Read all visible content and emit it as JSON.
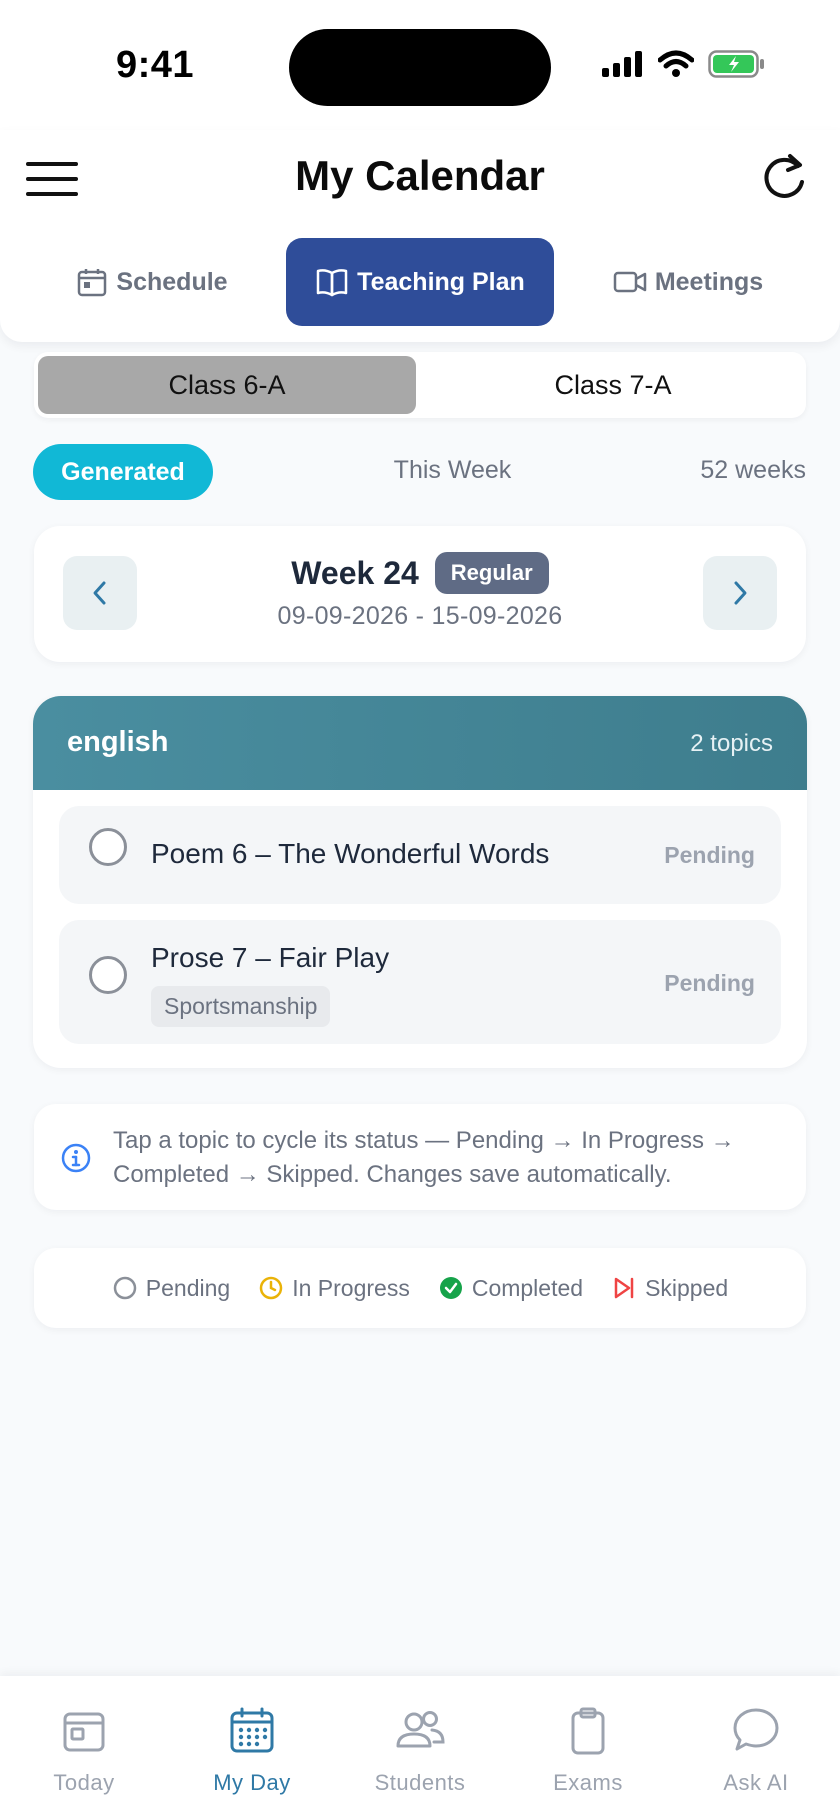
{
  "status_bar": {
    "time": "9:41"
  },
  "header": {
    "title": "My Calendar"
  },
  "tabs": [
    {
      "label": "Schedule",
      "icon": "calendar-icon",
      "active": false
    },
    {
      "label": "Teaching Plan",
      "icon": "book-open-icon",
      "active": true
    },
    {
      "label": "Meetings",
      "icon": "video-icon",
      "active": false
    }
  ],
  "classes": [
    {
      "label": "Class 6-A",
      "selected": true
    },
    {
      "label": "Class 7-A",
      "selected": false
    }
  ],
  "filters": {
    "generated": "Generated",
    "this_week": "This Week",
    "weeks_count": "52 weeks"
  },
  "week": {
    "title": "Week 24",
    "badge": "Regular",
    "range": "09-09-2026 - 15-09-2026"
  },
  "subject": {
    "name": "english",
    "topic_count": "2 topics",
    "topics": [
      {
        "title": "Poem 6 – The Wonderful Words",
        "status": "Pending",
        "tag": ""
      },
      {
        "title": "Prose 7 – Fair Play",
        "status": "Pending",
        "tag": "Sportsmanship"
      }
    ]
  },
  "info": {
    "text": "Tap a topic to cycle its status — Pending → In Progress → Completed → Skipped. Changes save automatically."
  },
  "legend": [
    {
      "label": "Pending",
      "icon": "circle-icon",
      "color": "#8b9099"
    },
    {
      "label": "In Progress",
      "icon": "clock-icon",
      "color": "#eab308"
    },
    {
      "label": "Completed",
      "icon": "check-circle-icon",
      "color": "#16a34a"
    },
    {
      "label": "Skipped",
      "icon": "skip-icon",
      "color": "#ef4444"
    }
  ],
  "bottom_nav": [
    {
      "label": "Today",
      "icon": "calendar-day-icon",
      "active": false
    },
    {
      "label": "My Day",
      "icon": "calendar-grid-icon",
      "active": true
    },
    {
      "label": "Students",
      "icon": "users-icon",
      "active": false
    },
    {
      "label": "Exams",
      "icon": "clipboard-icon",
      "active": false
    },
    {
      "label": "Ask AI",
      "icon": "chat-bubble-icon",
      "active": false
    }
  ],
  "colors": {
    "primary": "#2f4d99",
    "accent": "#11b8d6",
    "subject_header": "#4a8ea0",
    "nav_active": "#2f79a6"
  }
}
